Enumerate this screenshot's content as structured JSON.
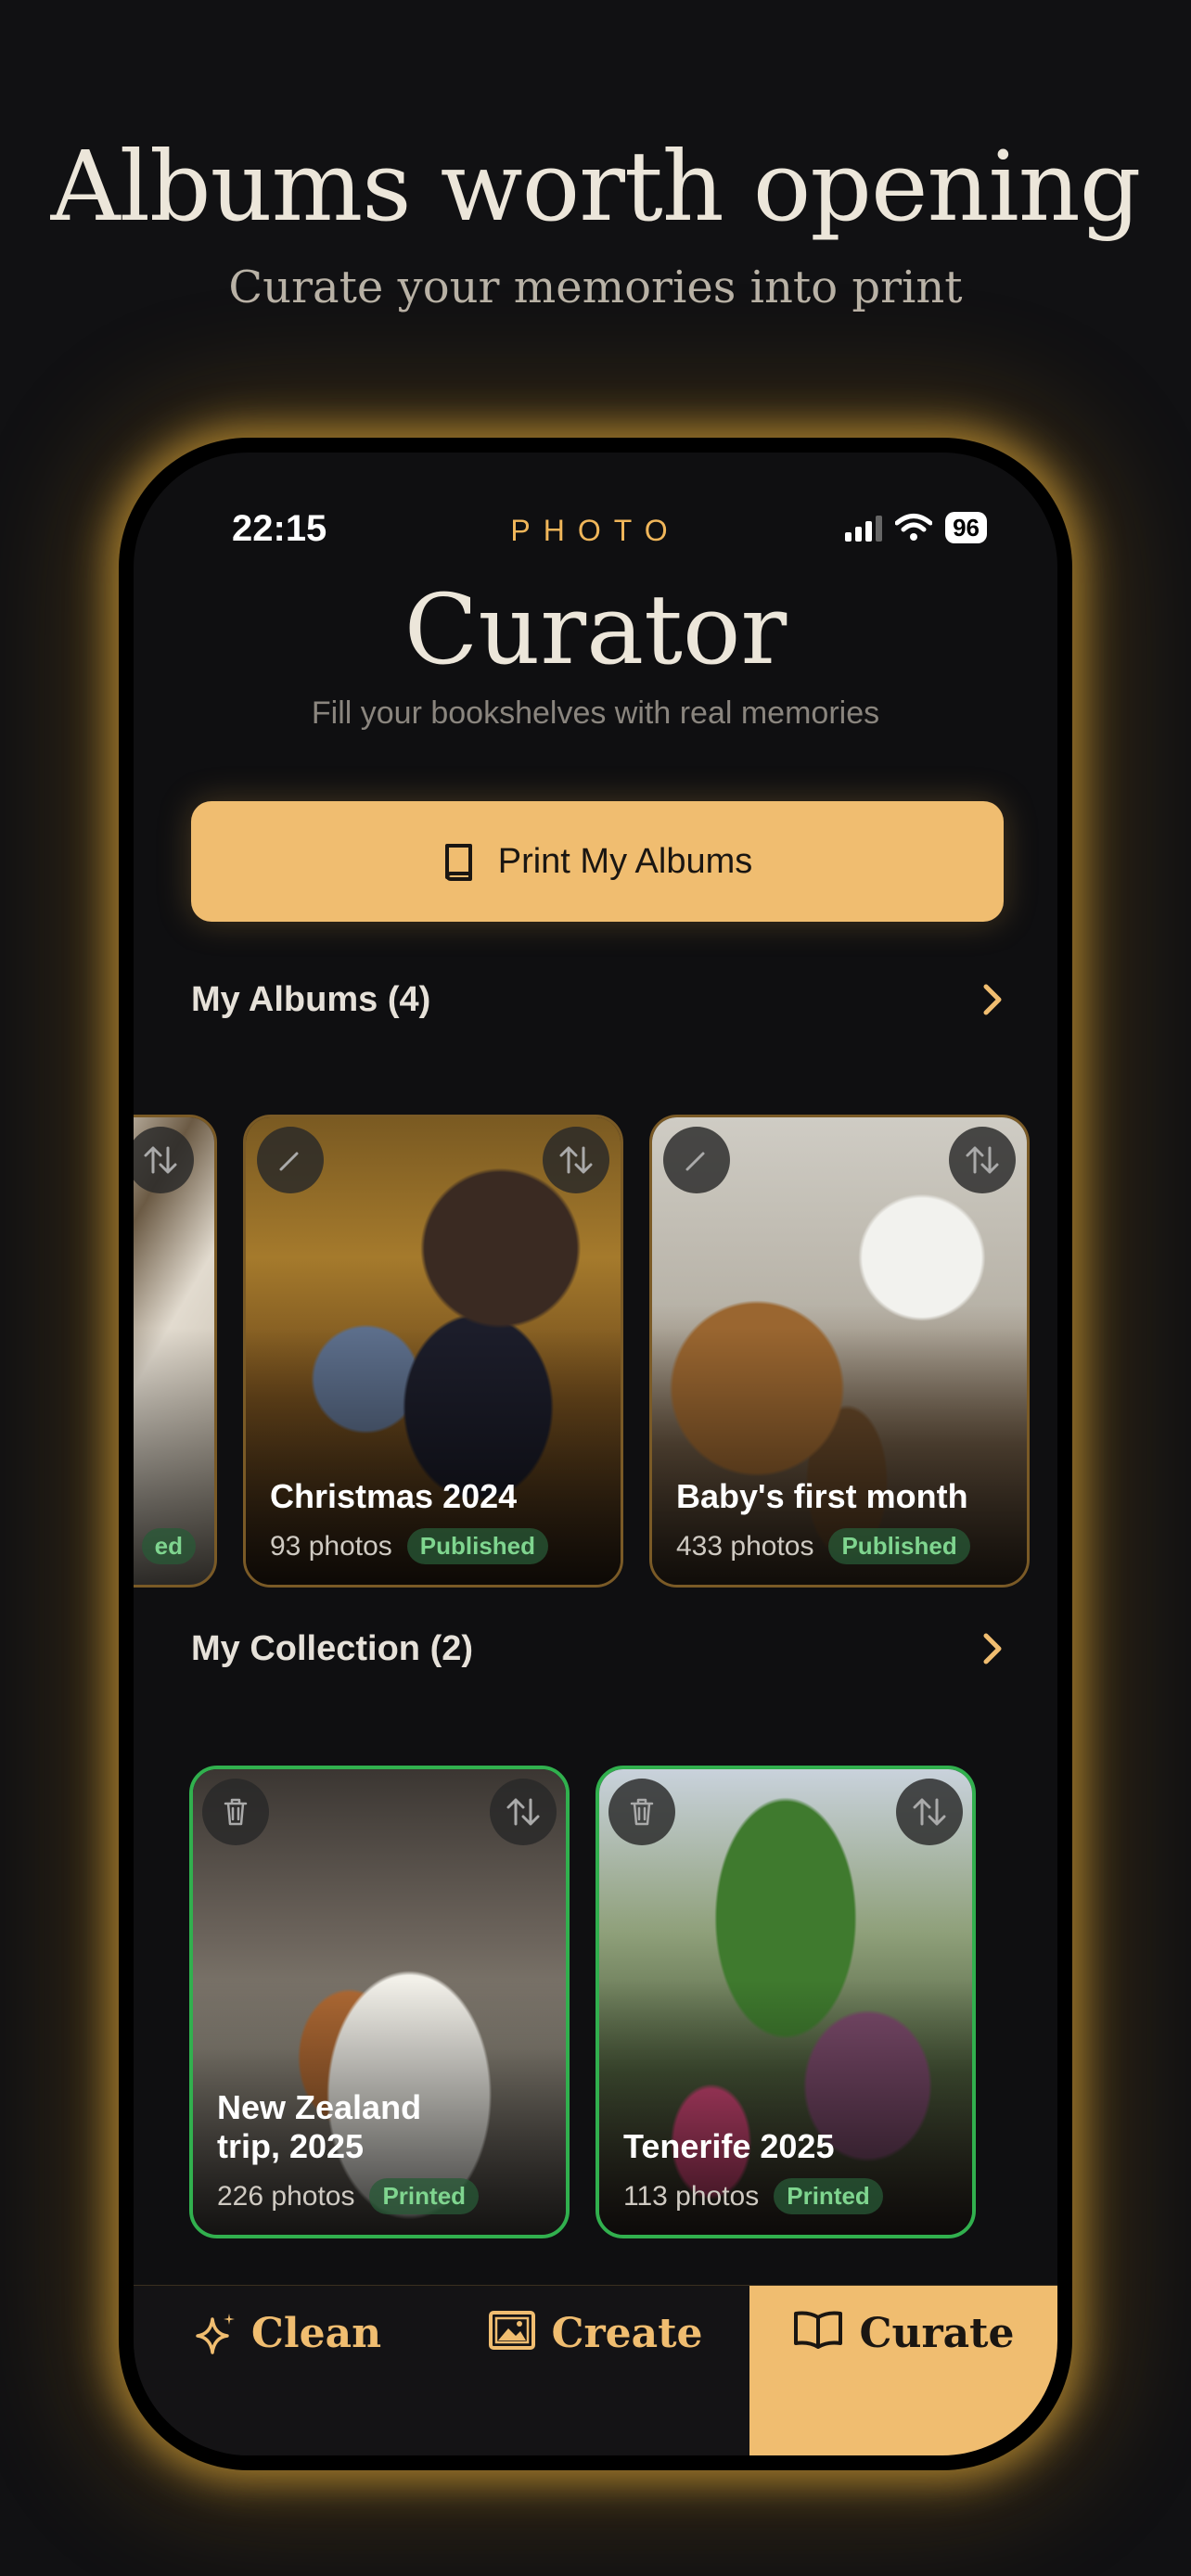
{
  "hero": {
    "title": "Albums worth opening",
    "subtitle": "Curate your memories into print"
  },
  "status_bar": {
    "time": "22:15",
    "brand": "PHOTO",
    "battery": "96"
  },
  "app": {
    "title": "Curator",
    "subtitle": "Fill your bookshelves with real memories"
  },
  "print_button": {
    "label": "Print My Albums",
    "icon": "book-icon"
  },
  "albums_section": {
    "label": "My Albums (4)",
    "albums": [
      {
        "title": "",
        "badge": "ed"
      },
      {
        "title": "Christmas 2024",
        "count": "93 photos",
        "badge": "Published"
      },
      {
        "title": "Baby's first month",
        "count": "433 photos",
        "badge": "Published"
      }
    ]
  },
  "collection_section": {
    "label": "My Collection (2)",
    "items": [
      {
        "title": "New Zealand trip, 2025",
        "count": "226 photos",
        "badge": "Printed"
      },
      {
        "title": "Tenerife 2025",
        "count": "113 photos",
        "badge": "Printed"
      }
    ]
  },
  "tabs": [
    {
      "label": "Clean",
      "icon": "sparkle-icon",
      "active": false
    },
    {
      "label": "Create",
      "icon": "image-icon",
      "active": false
    },
    {
      "label": "Curate",
      "icon": "open-book-icon",
      "active": true
    }
  ],
  "colors": {
    "accent": "#f0bd70",
    "brand": "#f0b65a",
    "printed_border": "#31b04e",
    "album_border": "#7a5a26",
    "background": "#111113"
  }
}
